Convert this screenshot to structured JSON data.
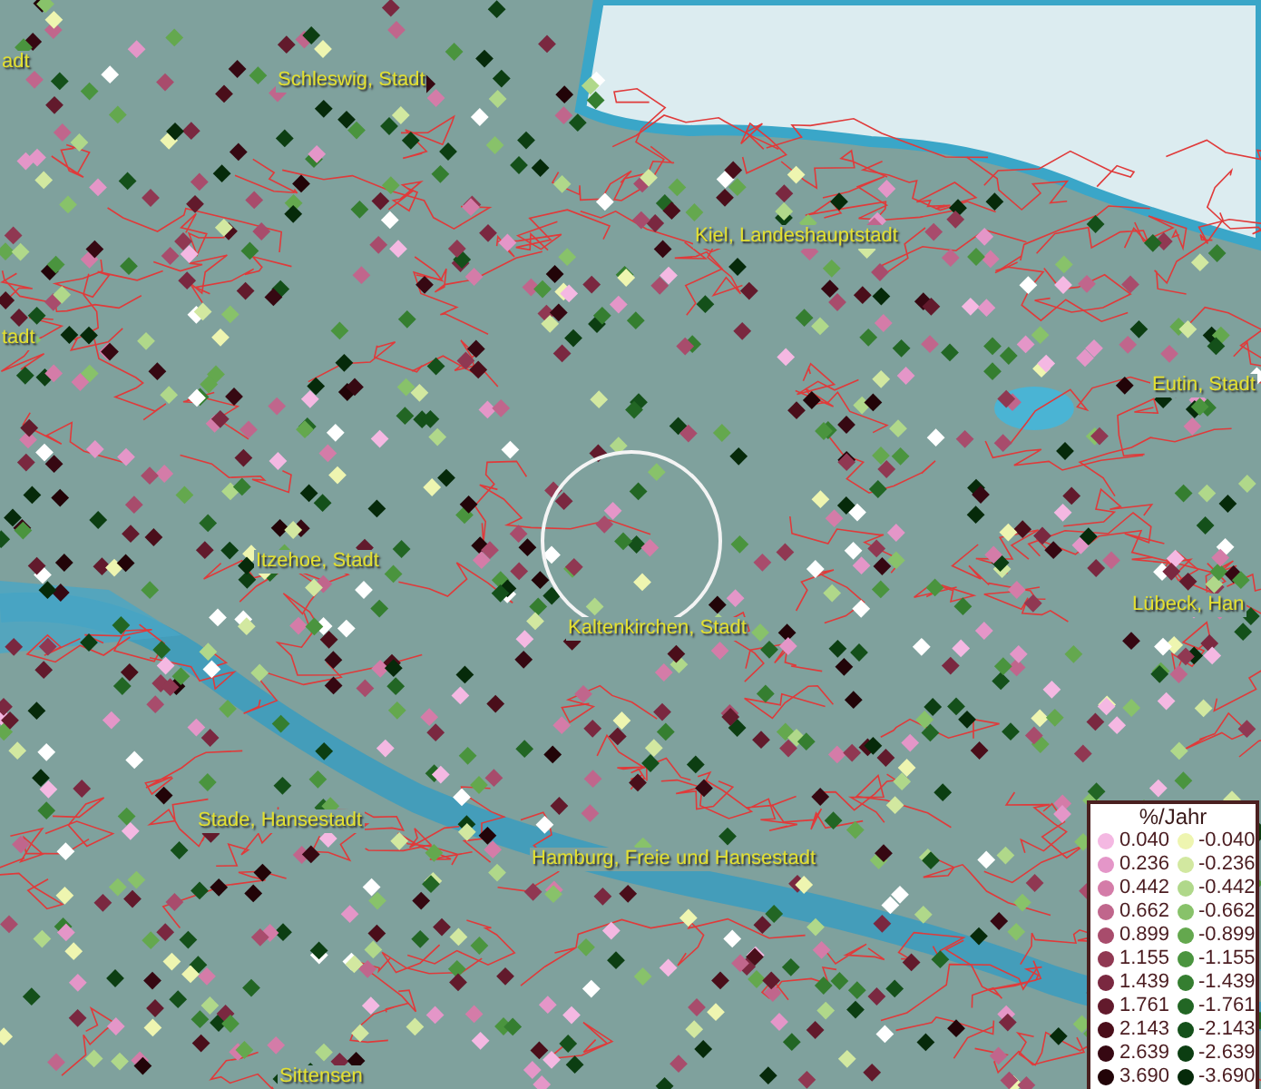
{
  "map": {
    "labels": [
      {
        "text": "adt"
      },
      {
        "text": "Schleswig, Stadt"
      },
      {
        "text": "Kiel, Landeshauptstadt"
      },
      {
        "text": "tadt"
      },
      {
        "text": "Eutin, Stadt"
      },
      {
        "text": "Itzehoe, Stadt"
      },
      {
        "text": "Lübeck, Han"
      },
      {
        "text": "Kaltenkirchen, Stadt"
      },
      {
        "text": "Stade, Hansestadt"
      },
      {
        "text": "Hamburg, Freie und Hansestadt"
      },
      {
        "text": "Sittensen"
      }
    ]
  },
  "legend": {
    "title": "%/Jahr",
    "positive": [
      {
        "label": "0.040",
        "color": "#f4b8e2"
      },
      {
        "label": "0.236",
        "color": "#e496c8"
      },
      {
        "label": "0.442",
        "color": "#d47ca8"
      },
      {
        "label": "0.662",
        "color": "#c0668c"
      },
      {
        "label": "0.899",
        "color": "#a84c6c"
      },
      {
        "label": "1.155",
        "color": "#903852"
      },
      {
        "label": "1.439",
        "color": "#7a2840"
      },
      {
        "label": "1.761",
        "color": "#621a2c"
      },
      {
        "label": "2.143",
        "color": "#4a0e1a"
      },
      {
        "label": "2.639",
        "color": "#360812"
      },
      {
        "label": "3.690",
        "color": "#220408"
      }
    ],
    "negative": [
      {
        "label": "-0.040",
        "color": "#eef5b0"
      },
      {
        "label": "-0.236",
        "color": "#d2e8a0"
      },
      {
        "label": "-0.442",
        "color": "#b0d88a"
      },
      {
        "label": "-0.662",
        "color": "#88c26a"
      },
      {
        "label": "-0.899",
        "color": "#64a84e"
      },
      {
        "label": "-1.155",
        "color": "#4a943e"
      },
      {
        "label": "-1.439",
        "color": "#357e30"
      },
      {
        "label": "-1.761",
        "color": "#226624"
      },
      {
        "label": "-2.143",
        "color": "#14501a"
      },
      {
        "label": "-2.639",
        "color": "#0c3e12"
      },
      {
        "label": "-3.690",
        "color": "#062a0a"
      }
    ]
  }
}
